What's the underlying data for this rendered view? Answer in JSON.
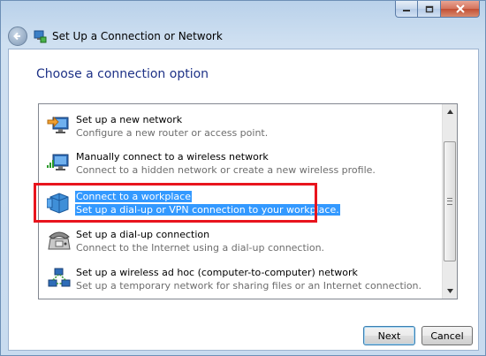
{
  "window": {
    "title": "Set Up a Connection or Network",
    "controls": {
      "minimize": "minimize",
      "maximize": "maximize",
      "close": "close"
    }
  },
  "heading": "Choose a connection option",
  "options": [
    {
      "title": "Set up a new network",
      "desc": "Configure a new router or access point.",
      "icon": "new-network-icon",
      "selected": false
    },
    {
      "title": "Manually connect to a wireless network",
      "desc": "Connect to a hidden network or create a new wireless profile.",
      "icon": "wireless-network-icon",
      "selected": false
    },
    {
      "title": "Connect to a workplace",
      "desc": "Set up a dial-up or VPN connection to your workplace.",
      "icon": "workplace-icon",
      "selected": true
    },
    {
      "title": "Set up a dial-up connection",
      "desc": "Connect to the Internet using a dial-up connection.",
      "icon": "dialup-phone-icon",
      "selected": false
    },
    {
      "title": "Set up a wireless ad hoc (computer-to-computer) network",
      "desc": "Set up a temporary network for sharing files or an Internet connection.",
      "icon": "adhoc-network-icon",
      "selected": false
    }
  ],
  "buttons": {
    "next": "Next",
    "cancel": "Cancel"
  },
  "colors": {
    "selection": "#3399ff",
    "highlight_box": "#e8141d",
    "heading": "#1e3287"
  }
}
